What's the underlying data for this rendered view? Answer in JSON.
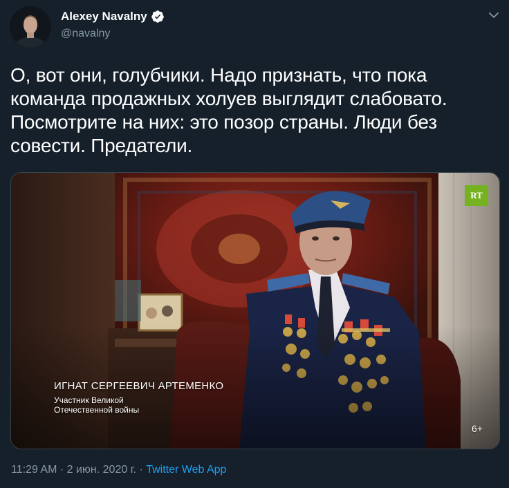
{
  "author": {
    "name": "Alexey Navalny",
    "handle": "@navalny"
  },
  "tweet": {
    "text": "О, вот они, голубчики. Надо признать, что пока команда продажных холуев выглядит слабовато. Посмотрите на них: это позор страны. Люди без совести. Предатели."
  },
  "media": {
    "channel_logo": "RT",
    "caption_name": "ИГНАТ СЕРГЕЕВИЧ АРТЕМЕНКО",
    "caption_line1": "Участник Великой",
    "caption_line2": "Отечественной войны",
    "age_rating": "6+"
  },
  "footer": {
    "time": "11:29 AM",
    "separator1": " · ",
    "date": "2 июн. 2020 г.",
    "separator2": " · ",
    "source": "Twitter Web App"
  },
  "colors": {
    "background": "#15202b",
    "secondary_text": "#8899a6",
    "link": "#1da1f2",
    "verified": "#ffffff",
    "rt_green": "#74b21f"
  },
  "icons": {
    "verified": "verified-badge-icon",
    "menu": "chevron-down-icon"
  }
}
